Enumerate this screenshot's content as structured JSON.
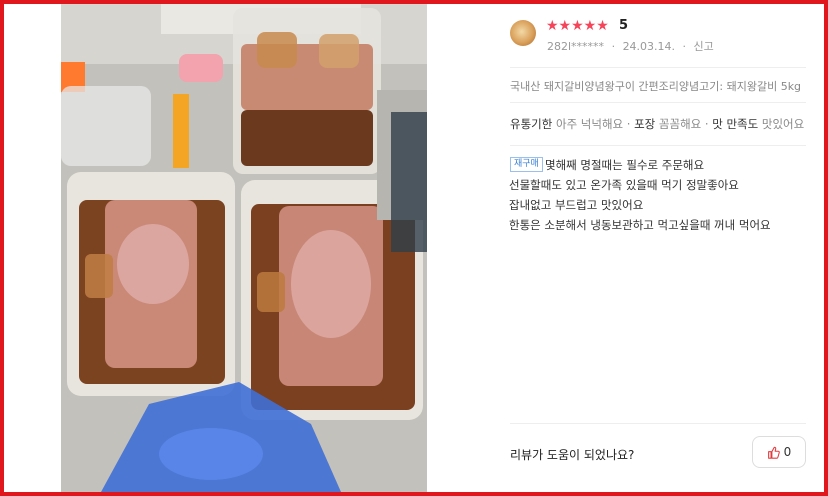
{
  "review": {
    "stars": "★★★★★",
    "score": "5",
    "reviewer": "282l******",
    "date": "24.03.14.",
    "report": "신고",
    "product": "국내산 돼지갈비양념왕구이 간편조리양념고기: 돼지왕갈비 5kg",
    "opinions": {
      "expiry_label": "유통기한",
      "expiry_value": "아주 넉넉해요",
      "packaging_label": "포장",
      "packaging_value": "꼼꼼해요",
      "taste_label": "맛 만족도",
      "taste_value": "맛있어요"
    },
    "repurchase_badge": "재구매",
    "lines": [
      "몇해째 명절때는 필수로 주문해요",
      "선물할때도 있고 온가족 있을때 먹기 정말좋아요",
      "잡내없고 부드럽고 맛있어요",
      "한통은 소분해서  냉동보관하고 먹고싶을때 꺼내 먹어요"
    ],
    "helpful_question": "리뷰가 도움이 되었나요?",
    "like_count": "0"
  },
  "colors": {
    "frame": "#e0181d",
    "star": "#f4455a",
    "badge": "#3b82d6",
    "like_icon": "#e5383b"
  },
  "icons": {
    "like": "thumbs-up-icon"
  }
}
